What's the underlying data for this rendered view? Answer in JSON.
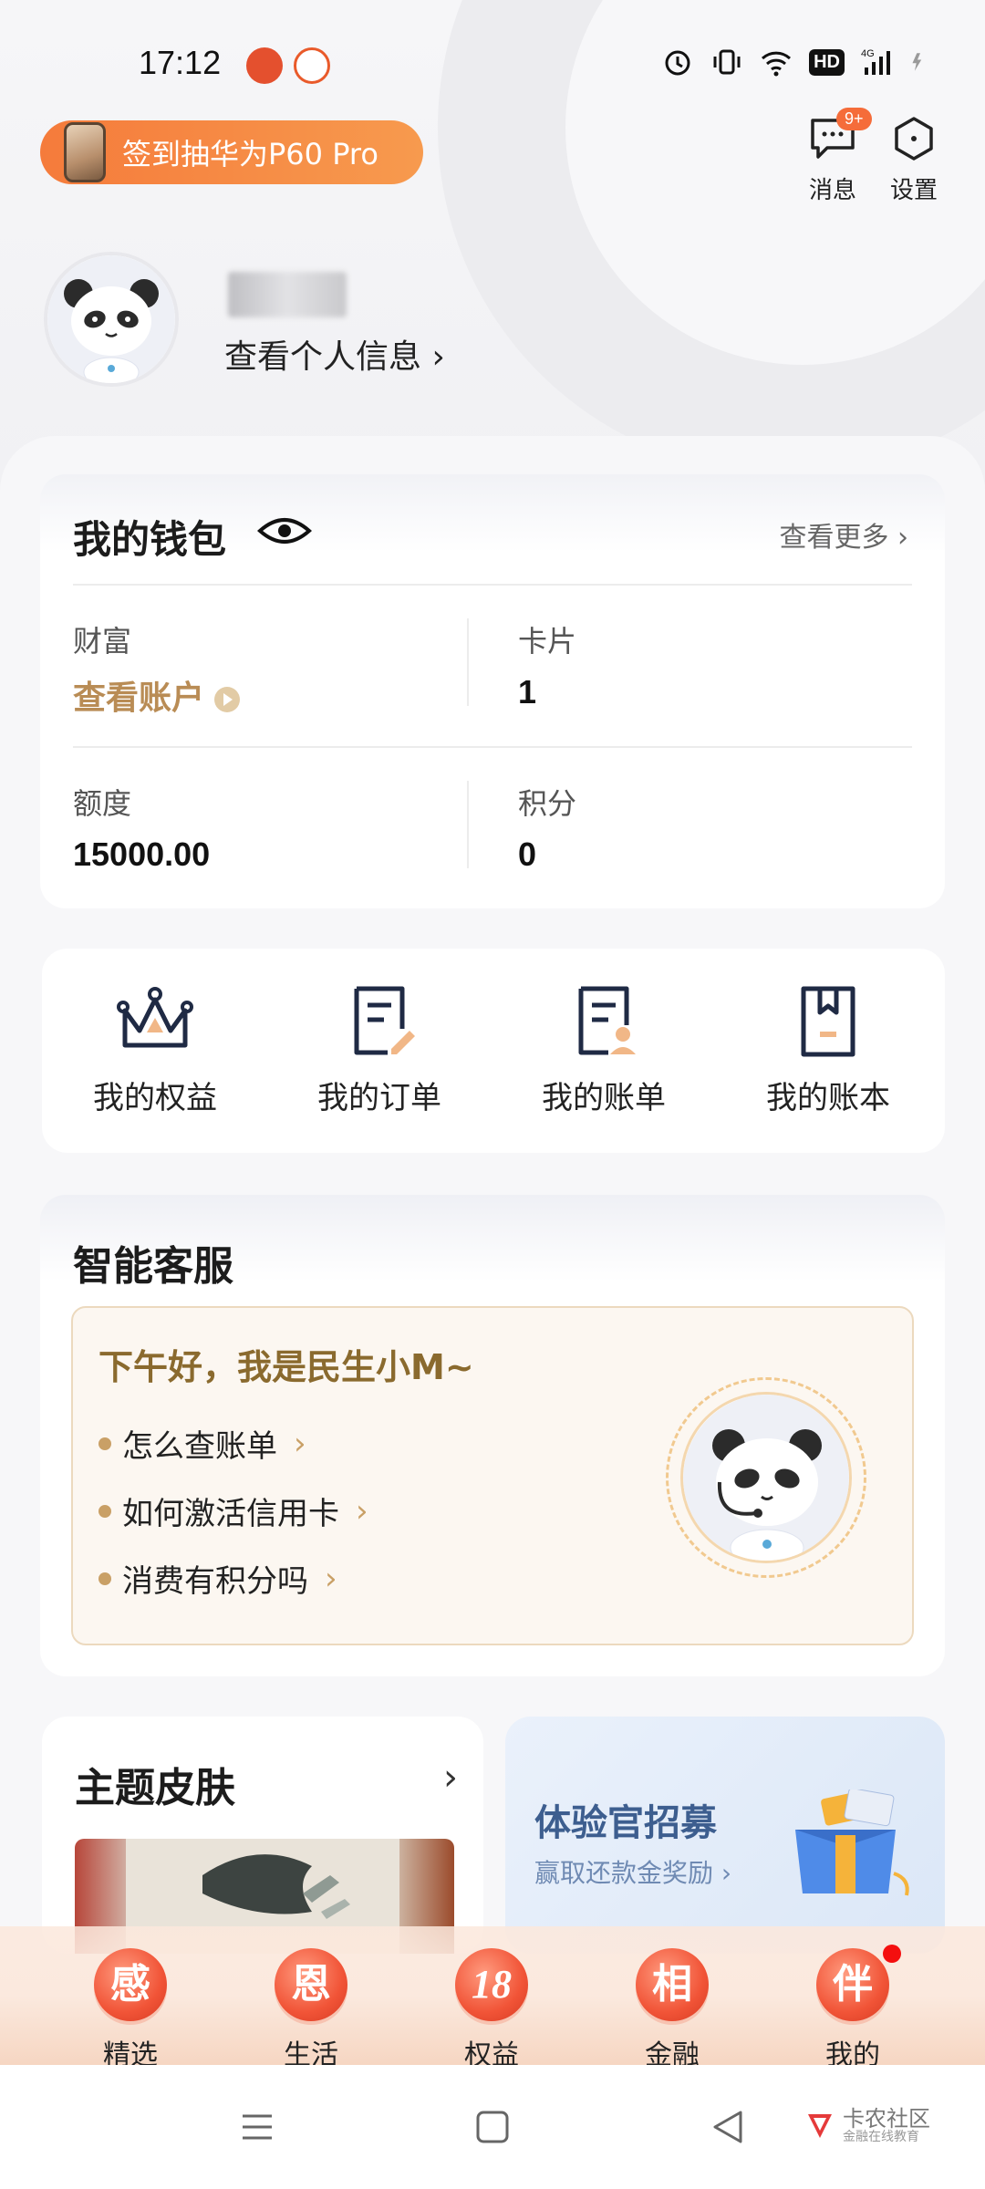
{
  "status_bar": {
    "time": "17:12",
    "hd": "HD",
    "network": "4G"
  },
  "header": {
    "promo_text": "签到抽华为P60 Pro",
    "messages_label": "消息",
    "messages_badge": "9+",
    "settings_label": "设置"
  },
  "profile": {
    "view_info_label": "查看个人信息 ›"
  },
  "wallet": {
    "title": "我的钱包",
    "more_label": "查看更多 ›",
    "items": [
      {
        "label": "财富",
        "value": "查看账户"
      },
      {
        "label": "卡片",
        "value": "1"
      },
      {
        "label": "额度",
        "value": "15000.00"
      },
      {
        "label": "积分",
        "value": "0"
      }
    ]
  },
  "quick_actions": [
    {
      "label": "我的权益",
      "icon": "crown-icon"
    },
    {
      "label": "我的订单",
      "icon": "order-icon"
    },
    {
      "label": "我的账单",
      "icon": "bill-icon"
    },
    {
      "label": "我的账本",
      "icon": "ledger-icon"
    }
  ],
  "service": {
    "title": "智能客服",
    "greeting": "下午好，我是民生小M~",
    "faqs": [
      "怎么查账单",
      "如何激活信用卡",
      "消费有积分吗"
    ]
  },
  "theme": {
    "title": "主题皮肤"
  },
  "recruit": {
    "title": "体验官招募",
    "subtitle": "赢取还款金奖励 ›"
  },
  "tabs": [
    {
      "glyph": "感",
      "label": "精选"
    },
    {
      "glyph": "恩",
      "label": "生活"
    },
    {
      "glyph": "18",
      "label": "权益"
    },
    {
      "glyph": "相",
      "label": "金融"
    },
    {
      "glyph": "伴",
      "label": "我的"
    }
  ],
  "watermark": {
    "name": "卡农社区",
    "sub": "金融在线教育"
  },
  "colors": {
    "accent_orange": "#f57b3b",
    "gold": "#b98c55",
    "tab_red": "#f15437"
  }
}
